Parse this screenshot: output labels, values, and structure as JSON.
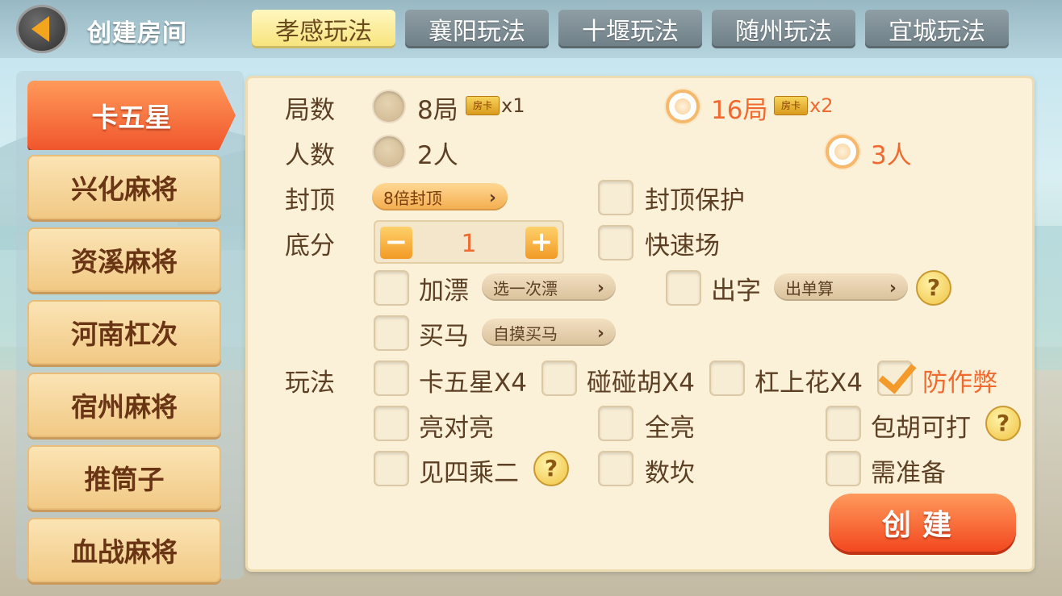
{
  "header": {
    "title": "创建房间",
    "back_icon": "back-arrow-icon"
  },
  "tabs": [
    {
      "label": "孝感玩法",
      "active": true
    },
    {
      "label": "襄阳玩法",
      "active": false
    },
    {
      "label": "十堰玩法",
      "active": false
    },
    {
      "label": "随州玩法",
      "active": false
    },
    {
      "label": "宜城玩法",
      "active": false
    }
  ],
  "sidebar": {
    "items": [
      {
        "label": "卡五星",
        "active": true
      },
      {
        "label": "兴化麻将",
        "active": false
      },
      {
        "label": "资溪麻将",
        "active": false
      },
      {
        "label": "河南杠次",
        "active": false
      },
      {
        "label": "宿州麻将",
        "active": false
      },
      {
        "label": "推筒子",
        "active": false
      },
      {
        "label": "血战麻将",
        "active": false
      }
    ]
  },
  "panel": {
    "rounds": {
      "label": "局数",
      "options": [
        {
          "text": "8局",
          "card": "房卡",
          "mult": "x1",
          "selected": false
        },
        {
          "text": "16局",
          "card": "房卡",
          "mult": "x2",
          "selected": true
        }
      ]
    },
    "players": {
      "label": "人数",
      "options": [
        {
          "text": "2人",
          "selected": false
        },
        {
          "text": "3人",
          "selected": true
        }
      ]
    },
    "cap": {
      "label": "封顶",
      "dropdown": "8倍封顶",
      "protect": {
        "text": "封顶保护",
        "checked": false
      }
    },
    "base": {
      "label": "底分",
      "value": "1",
      "minus": "−",
      "plus": "+",
      "fast": {
        "text": "快速场",
        "checked": false
      }
    },
    "piao": {
      "text": "加漂",
      "checked": false,
      "dropdown": "选一次漂"
    },
    "chuzi": {
      "text": "出字",
      "checked": false,
      "dropdown": "出单算"
    },
    "maima": {
      "text": "买马",
      "checked": false,
      "dropdown": "自摸买马"
    },
    "rules": {
      "label": "玩法",
      "options": [
        {
          "text": "卡五星X4",
          "checked": false
        },
        {
          "text": "碰碰胡X4",
          "checked": false
        },
        {
          "text": "杠上花X4",
          "checked": false
        },
        {
          "text": "防作弊",
          "checked": true
        },
        {
          "text": "亮对亮",
          "checked": false
        },
        {
          "text": "全亮",
          "checked": false
        },
        {
          "text": "包胡可打",
          "checked": false
        },
        {
          "text": "见四乘二",
          "checked": false
        },
        {
          "text": "数坎",
          "checked": false
        },
        {
          "text": "需准备",
          "checked": false
        }
      ]
    },
    "help_mark": "?",
    "chevron": "›",
    "create_label": "创建"
  },
  "colors": {
    "accent": "#f06a30",
    "tab_active": "#f7e37a",
    "panel_bg": "#faf1d8",
    "text": "#5d3f24"
  }
}
